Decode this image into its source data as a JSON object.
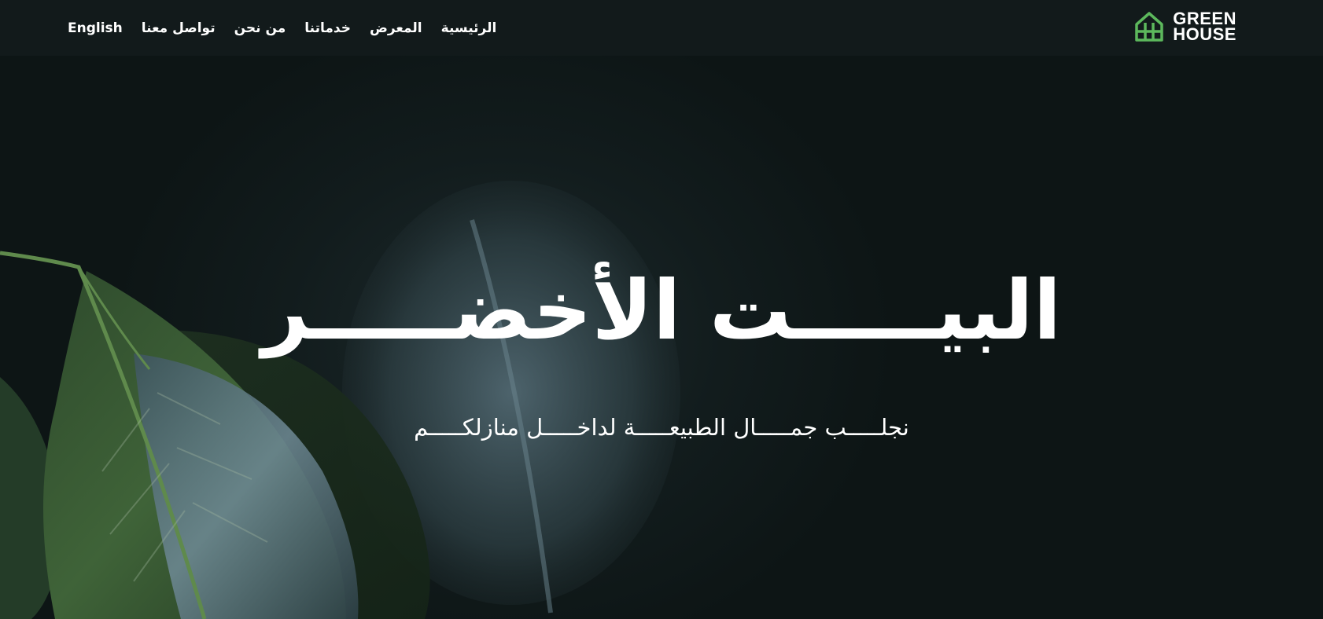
{
  "nav": {
    "language_toggle": "English",
    "items": [
      {
        "label": "تواصل معنا"
      },
      {
        "label": "من نحن"
      },
      {
        "label": "خدماتنا"
      },
      {
        "label": "المعرض"
      },
      {
        "label": "الرئيسية"
      }
    ]
  },
  "logo": {
    "line1": "GREEN",
    "line2": "HOUSE",
    "icon": "greenhouse-icon",
    "color": "#5cb85c"
  },
  "hero": {
    "title": "البيـــــت الأخضـــــر",
    "subtitle": "نجلـــــب جمـــــال الطبيعـــــة لداخـــــل منازلكـــــم",
    "background": "dark-leaves-photo"
  },
  "colors": {
    "navbar_bg": "#121a1b",
    "hero_bg": "#0e1616",
    "text": "#ffffff",
    "accent": "#5cb85c"
  }
}
